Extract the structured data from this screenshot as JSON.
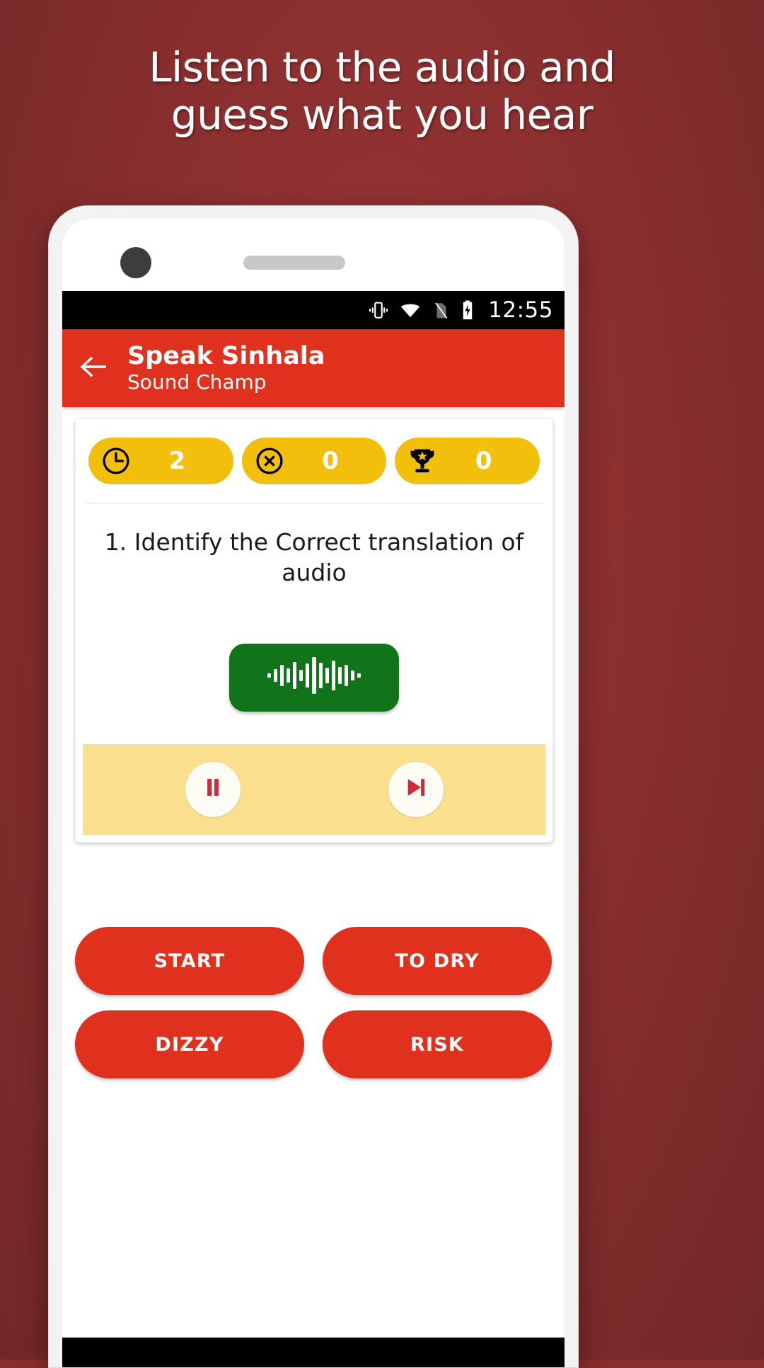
{
  "promo": {
    "line1": "Listen to the audio and",
    "line2": "guess what you hear"
  },
  "statusbar": {
    "vibrate_icon": "vibrate-icon",
    "wifi_icon": "wifi-icon",
    "sim_off_icon": "sim-card-off-icon",
    "battery_icon": "battery-charging-icon",
    "time": "12:55"
  },
  "appbar": {
    "back_icon": "back-arrow-icon",
    "title": "Speak Sinhala",
    "subtitle": "Sound Champ"
  },
  "stats": [
    {
      "icon": "clock-icon",
      "value": "2",
      "name": "timer-chip"
    },
    {
      "icon": "x-circle-icon",
      "value": "0",
      "name": "wrong-chip"
    },
    {
      "icon": "trophy-icon",
      "value": "0",
      "name": "score-chip"
    }
  ],
  "question": {
    "text": "1. Identify the Correct translation of  audio"
  },
  "player": {
    "audio_button_icon": "audio-waveform-icon",
    "pause_icon": "pause-icon",
    "next_icon": "skip-next-icon"
  },
  "answers": [
    {
      "label": "START"
    },
    {
      "label": "TO DRY"
    },
    {
      "label": "DIZZY"
    },
    {
      "label": "RISK"
    }
  ],
  "colors": {
    "background": "#8b2f2f",
    "appbar_red": "#e0301e",
    "chip_yellow": "#f2c00c",
    "player_yellow": "#fadf8e",
    "audio_green": "#11741a",
    "answer_red": "#e0301e"
  }
}
